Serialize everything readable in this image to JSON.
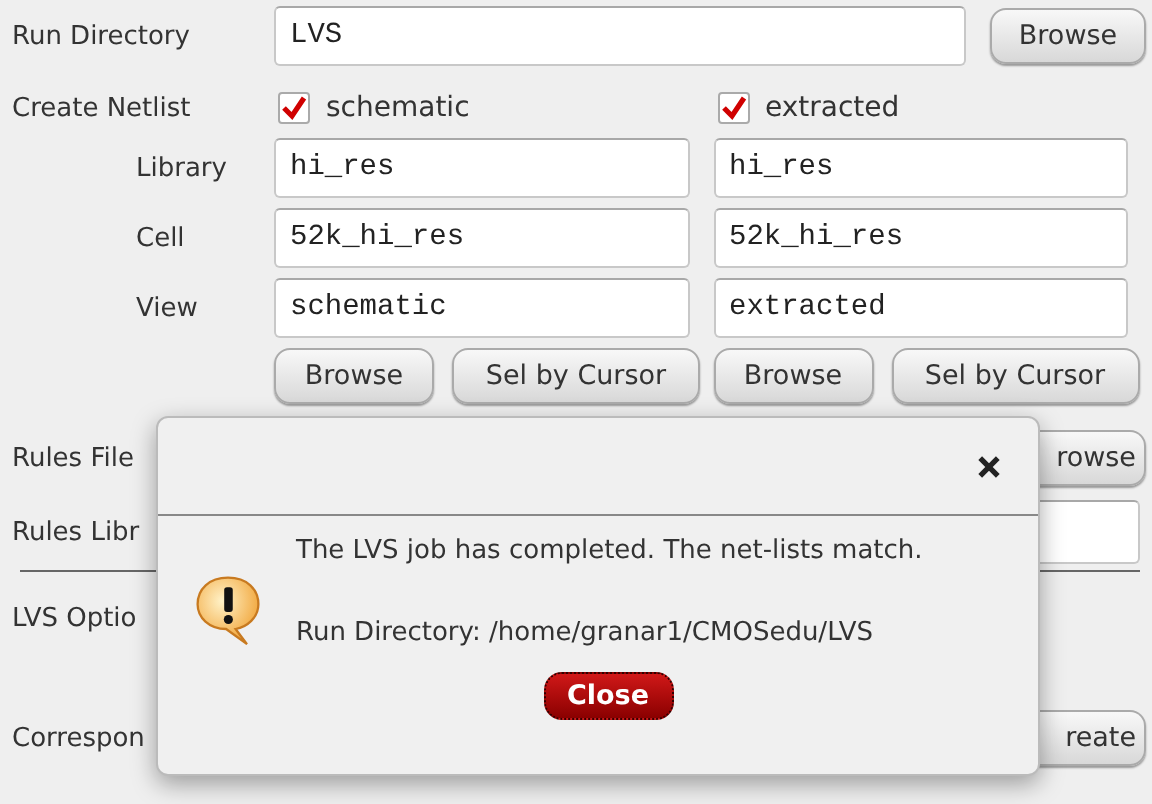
{
  "run_directory": {
    "label": "Run Directory",
    "value": "LVS",
    "button": "Browse"
  },
  "create_netlist": {
    "label": "Create Netlist",
    "options": [
      {
        "label": "schematic",
        "checked": true
      },
      {
        "label": "extracted",
        "checked": true
      }
    ]
  },
  "cell_rows": [
    {
      "label": "Library",
      "values": [
        "hi_res",
        "hi_res"
      ]
    },
    {
      "label": "Cell",
      "values": [
        "52k_hi_res",
        "52k_hi_res"
      ]
    },
    {
      "label": "View",
      "values": [
        "schematic",
        "extracted"
      ]
    }
  ],
  "column_buttons": [
    [
      "Browse",
      "Sel by Cursor"
    ],
    [
      "Browse",
      "Sel by Cursor"
    ]
  ],
  "lower_rows": [
    {
      "label": "Rules File",
      "kind": "button",
      "text": "rowse"
    },
    {
      "label": "Rules Libr",
      "kind": "field"
    },
    {
      "kind": "divider"
    },
    {
      "label": "LVS Optio",
      "kind": "none"
    },
    {
      "label": "Correspon",
      "kind": "button",
      "text": "reate"
    }
  ],
  "dialog": {
    "message": "The LVS job has completed. The net-lists match.",
    "detail": "Run Directory: /home/granar1/CMOSedu/LVS",
    "button": "Close"
  }
}
